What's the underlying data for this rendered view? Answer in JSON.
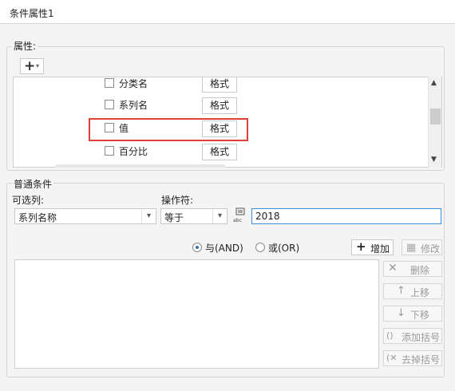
{
  "window": {
    "title": "条件属性1"
  },
  "attributes": {
    "legend": "属性:",
    "add_button": {
      "icon": "plus-icon",
      "caret": "▾"
    },
    "rows": [
      {
        "label": "分类名",
        "format": "格式",
        "checked": false
      },
      {
        "label": "系列名",
        "format": "格式",
        "checked": false
      },
      {
        "label": "值",
        "format": "格式",
        "checked": false,
        "highlighted": true
      },
      {
        "label": "百分比",
        "format": "格式",
        "checked": false
      }
    ]
  },
  "condition": {
    "legend": "普通条件",
    "column_label": "可选列:",
    "column_value": "系列名称",
    "operator_label": "操作符:",
    "operator_value": "等于",
    "value_type_icon": "abc-formula-icon",
    "value": "2018",
    "and_label": "与(AND)",
    "or_label": "或(OR)",
    "and_selected": true,
    "add_label": "增加",
    "modify_label": "修改",
    "delete_label": "删除",
    "up_label": "上移",
    "down_label": "下移",
    "add_paren_label": "添加括号",
    "remove_paren_label": "去掉括号"
  },
  "colors": {
    "highlight": "#e0403a",
    "input_focus": "#3c8fd6"
  }
}
